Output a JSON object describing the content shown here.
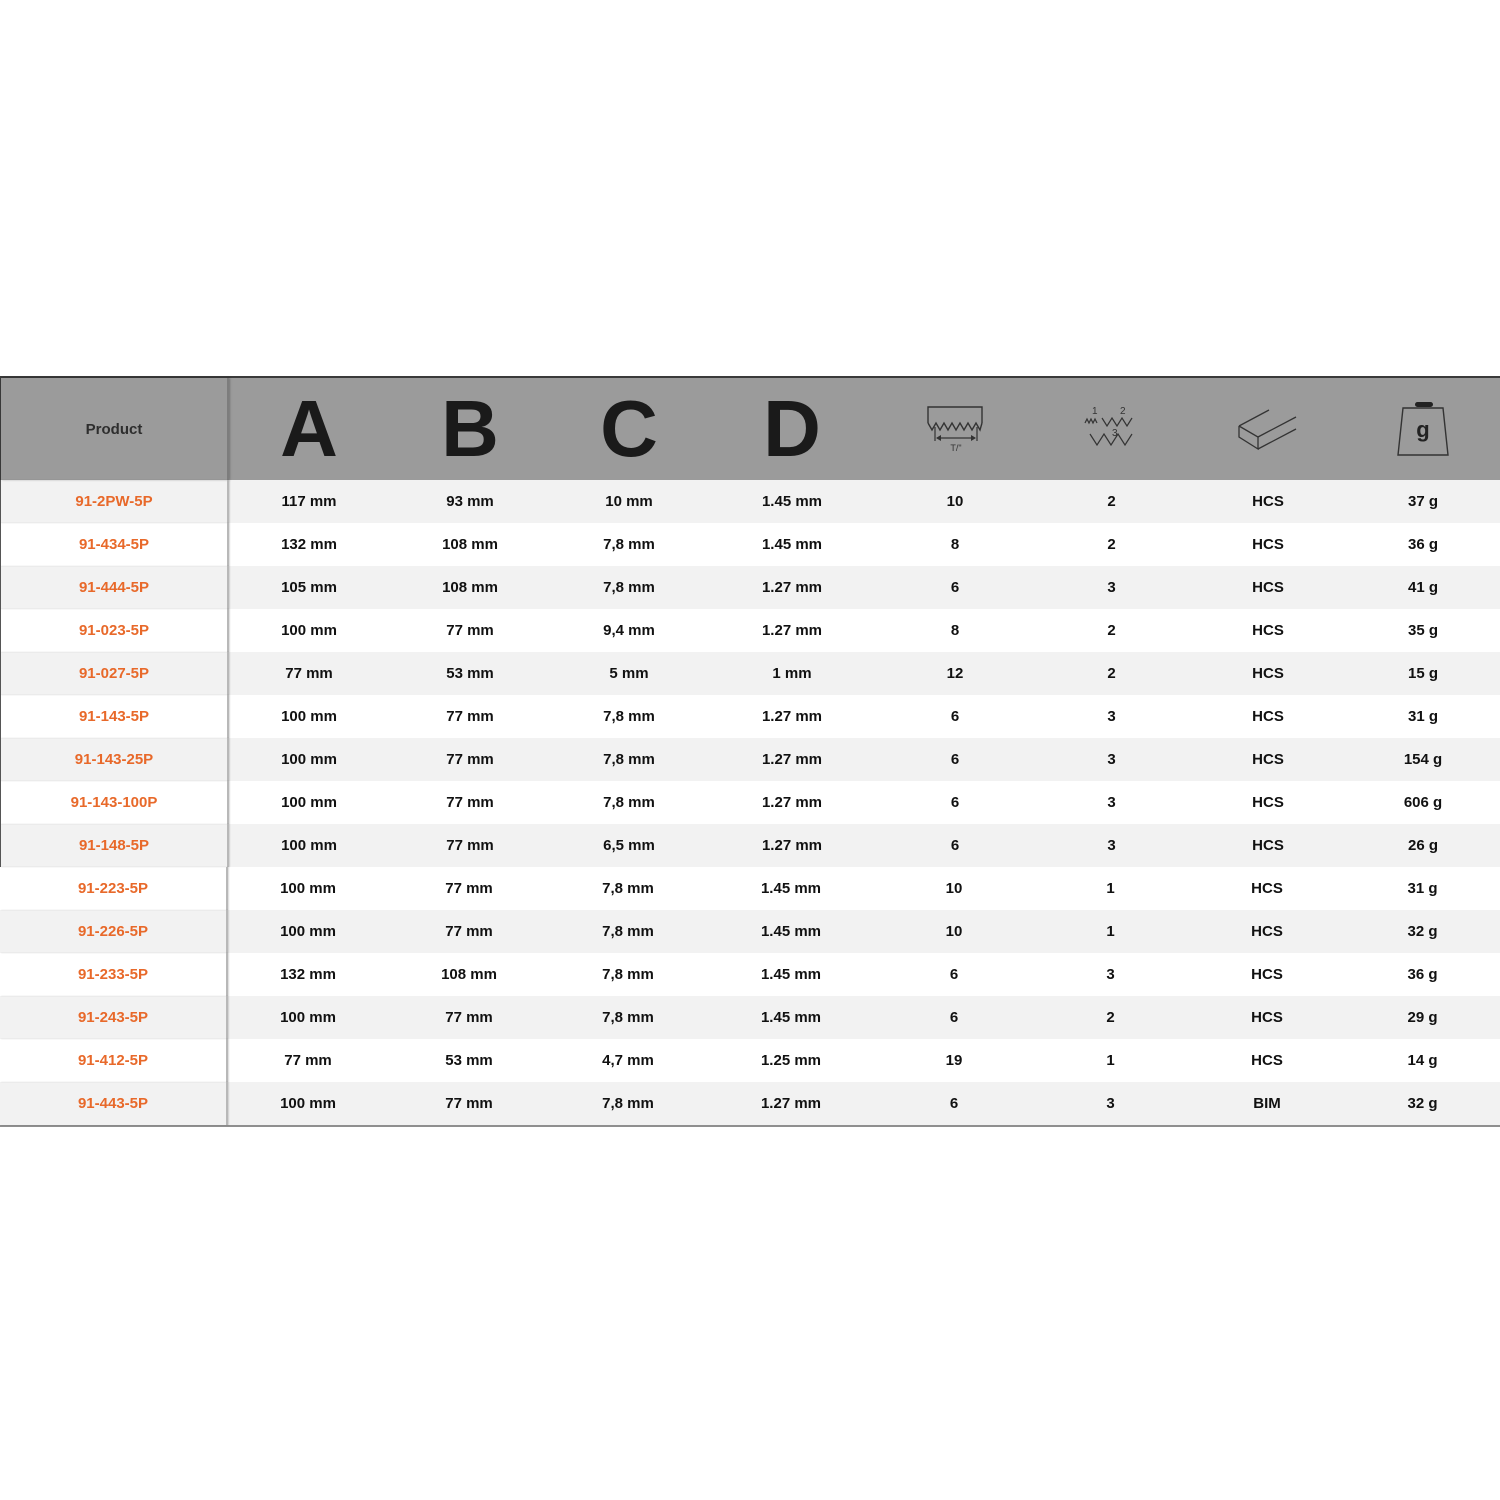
{
  "table": {
    "header": {
      "product_label": "Product",
      "letters": [
        "A",
        "B",
        "C",
        "D"
      ],
      "icons": [
        {
          "name": "tooth-pitch-icon",
          "caption": "T/\""
        },
        {
          "name": "tooth-set-icon",
          "numbers": [
            "1",
            "2",
            "3"
          ]
        },
        {
          "name": "material-bar-icon"
        },
        {
          "name": "weight-icon",
          "label": "g"
        }
      ]
    },
    "accent_color": "#e8692a",
    "header_bg": "#9b9b9b",
    "rows": [
      {
        "product": "91-2PW-5P",
        "a": "117 mm",
        "b": "93 mm",
        "c": "10 mm",
        "d": "1.45 mm",
        "tpi": "10",
        "set": "2",
        "material": "HCS",
        "weight": "37 g"
      },
      {
        "product": "91-434-5P",
        "a": "132 mm",
        "b": "108 mm",
        "c": "7,8 mm",
        "d": "1.45 mm",
        "tpi": "8",
        "set": "2",
        "material": "HCS",
        "weight": "36 g"
      },
      {
        "product": "91-444-5P",
        "a": "105 mm",
        "b": "108 mm",
        "c": "7,8 mm",
        "d": "1.27 mm",
        "tpi": "6",
        "set": "3",
        "material": "HCS",
        "weight": "41 g"
      },
      {
        "product": "91-023-5P",
        "a": "100 mm",
        "b": "77 mm",
        "c": "9,4 mm",
        "d": "1.27 mm",
        "tpi": "8",
        "set": "2",
        "material": "HCS",
        "weight": "35 g"
      },
      {
        "product": "91-027-5P",
        "a": "77 mm",
        "b": "53 mm",
        "c": "5 mm",
        "d": "1 mm",
        "tpi": "12",
        "set": "2",
        "material": "HCS",
        "weight": "15 g"
      },
      {
        "product": "91-143-5P",
        "a": "100 mm",
        "b": "77 mm",
        "c": "7,8 mm",
        "d": "1.27 mm",
        "tpi": "6",
        "set": "3",
        "material": "HCS",
        "weight": "31 g"
      },
      {
        "product": "91-143-25P",
        "a": "100 mm",
        "b": "77 mm",
        "c": "7,8 mm",
        "d": "1.27 mm",
        "tpi": "6",
        "set": "3",
        "material": "HCS",
        "weight": "154 g"
      },
      {
        "product": "91-143-100P",
        "a": "100 mm",
        "b": "77 mm",
        "c": "7,8 mm",
        "d": "1.27 mm",
        "tpi": "6",
        "set": "3",
        "material": "HCS",
        "weight": "606 g"
      },
      {
        "product": "91-148-5P",
        "a": "100 mm",
        "b": "77 mm",
        "c": "6,5 mm",
        "d": "1.27 mm",
        "tpi": "6",
        "set": "3",
        "material": "HCS",
        "weight": "26 g"
      },
      {
        "product": "91-223-5P",
        "a": "100 mm",
        "b": "77 mm",
        "c": "7,8 mm",
        "d": "1.45 mm",
        "tpi": "10",
        "set": "1",
        "material": "HCS",
        "weight": "31 g"
      },
      {
        "product": "91-226-5P",
        "a": "100 mm",
        "b": "77 mm",
        "c": "7,8 mm",
        "d": "1.45 mm",
        "tpi": "10",
        "set": "1",
        "material": "HCS",
        "weight": "32 g"
      },
      {
        "product": "91-233-5P",
        "a": "132 mm",
        "b": "108 mm",
        "c": "7,8 mm",
        "d": "1.45 mm",
        "tpi": "6",
        "set": "3",
        "material": "HCS",
        "weight": "36 g"
      },
      {
        "product": "91-243-5P",
        "a": "100 mm",
        "b": "77 mm",
        "c": "7,8 mm",
        "d": "1.45 mm",
        "tpi": "6",
        "set": "2",
        "material": "HCS",
        "weight": "29 g"
      },
      {
        "product": "91-412-5P",
        "a": "77 mm",
        "b": "53 mm",
        "c": "4,7 mm",
        "d": "1.25 mm",
        "tpi": "19",
        "set": "1",
        "material": "HCS",
        "weight": "14 g"
      },
      {
        "product": "91-443-5P",
        "a": "100 mm",
        "b": "77 mm",
        "c": "7,8 mm",
        "d": "1.27 mm",
        "tpi": "6",
        "set": "3",
        "material": "BIM",
        "weight": "32 g"
      }
    ]
  }
}
